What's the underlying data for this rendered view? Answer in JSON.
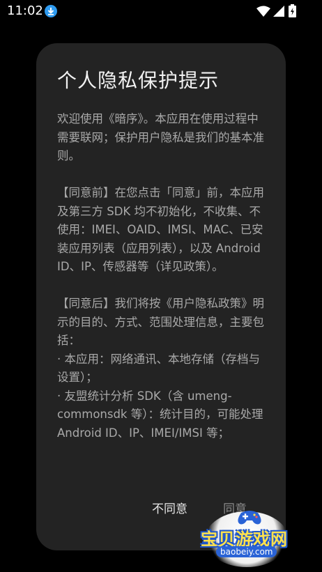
{
  "status_bar": {
    "time": "11:02",
    "icons": [
      "download-icon",
      "wifi-icon",
      "signal-icon",
      "battery-charging-icon"
    ]
  },
  "dialog": {
    "title": "个人隐私保护提示",
    "paragraphs": [
      "欢迎使用《暗序》。本应用在使用过程中需要联网；保护用户隐私是我们的基本准则。",
      "【同意前】在您点击「同意」前，本应用及第三方 SDK 均不初始化，不收集、不使用：IMEI、OAID、IMSI、MAC、已安装应用列表（应用列表），以及 Android ID、IP、传感器等（详见政策）。",
      "【同意后】我们将按《用户隐私政策》明示的目的、方式、范围处理信息，主要包括：\n· 本应用：网络通讯、本地存储（存档与设置）；\n· 友盟统计分析 SDK（含 umeng-commonsdk 等）：统计目的，可能处理 Android ID、IP、IMEI/IMSI 等；"
    ],
    "buttons": {
      "disagree": "不同意",
      "agree": "同意"
    }
  },
  "watermark": {
    "text": "宝贝游戏网",
    "url": "baobeiy.com"
  },
  "colors": {
    "background": "#000000",
    "dialog": "#232323",
    "title": "#f2f2f2",
    "body_text": "#a9a9a9",
    "watermark_yellow": "#ffe14d",
    "watermark_blue": "#1f56c9"
  }
}
